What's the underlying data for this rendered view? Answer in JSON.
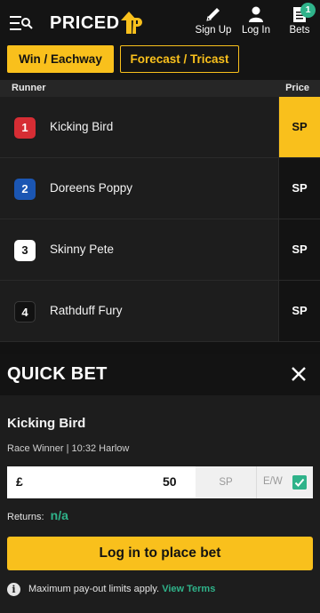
{
  "header": {
    "logo_text_a": "PRICED",
    "logo_text_b": "UP",
    "signup_label": "Sign Up",
    "login_label": "Log In",
    "bets_label": "Bets",
    "bets_count": "1",
    "icons": [
      "menu-icon",
      "search-icon",
      "pencil-icon",
      "user-icon",
      "betslip-icon"
    ]
  },
  "tabs": [
    {
      "label": "Win / Eachway",
      "active": true
    },
    {
      "label": "Forecast / Tricast",
      "active": false
    }
  ],
  "table": {
    "col_runner": "Runner",
    "col_price": "Price",
    "rows": [
      {
        "num": "1",
        "name": "Kicking Bird",
        "price": "SP",
        "selected": true,
        "color": "#d62d34"
      },
      {
        "num": "2",
        "name": "Doreens Poppy",
        "price": "SP",
        "selected": false,
        "color": "#1b56b3"
      },
      {
        "num": "3",
        "name": "Skinny Pete",
        "price": "SP",
        "selected": false,
        "color": "#ffffff"
      },
      {
        "num": "4",
        "name": "Rathduff Fury",
        "price": "SP",
        "selected": false,
        "color": "#111111"
      }
    ]
  },
  "quick_bet": {
    "title": "QUICK BET",
    "runner": "Kicking Bird",
    "race": "Race Winner  |  10:32 Harlow",
    "currency": "£",
    "stake": "50",
    "odds": "SP",
    "ew_label": "E/W",
    "ew_checked": true,
    "returns_label": "Returns:",
    "returns_value": "n/a",
    "login_button": "Log in to place bet",
    "info_text": "Maximum pay-out limits apply.",
    "info_link": "View Terms"
  },
  "colors": {
    "accent": "#f9c01c",
    "success": "#2fb38a",
    "background": "#121212"
  }
}
